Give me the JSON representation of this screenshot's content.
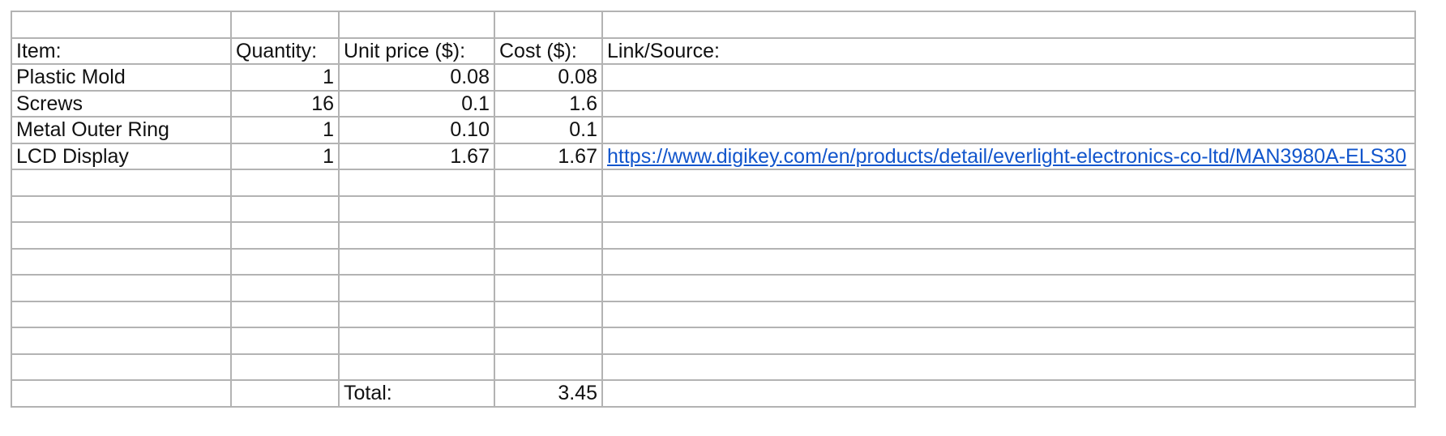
{
  "header": {
    "item": "Item:",
    "quantity": "Quantity:",
    "unit_price": "Unit price ($):",
    "cost": "Cost ($):",
    "link": "Link/Source:"
  },
  "rows": [
    {
      "item": "Plastic Mold",
      "quantity": "1",
      "unit_price": "0.08",
      "cost": "0.08",
      "link": ""
    },
    {
      "item": "Screws",
      "quantity": "16",
      "unit_price": "0.1",
      "cost": "1.6",
      "link": ""
    },
    {
      "item": "Metal Outer Ring",
      "quantity": "1",
      "unit_price": "0.10",
      "cost": "0.1",
      "link": ""
    },
    {
      "item": "LCD Display",
      "quantity": "1",
      "unit_price": "1.67",
      "cost": "1.67",
      "link": "https://www.digikey.com/en/products/detail/everlight-electronics-co-ltd/MAN3980A-ELS30"
    }
  ],
  "total": {
    "label": "Total:",
    "value": "3.45"
  },
  "colors": {
    "link": "#1155cc",
    "grid": "#b3b3b3"
  }
}
